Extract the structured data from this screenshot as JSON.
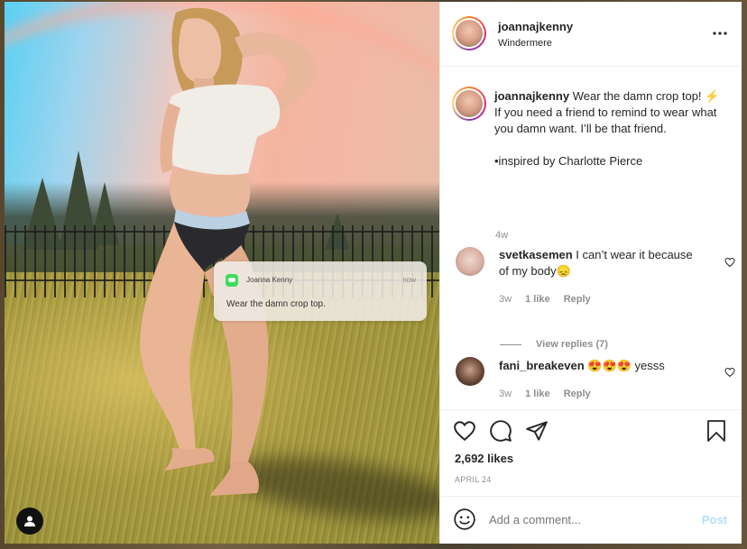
{
  "post": {
    "username": "joannajkenny",
    "location": "Windermere",
    "more_label": "•••",
    "caption_username": "joannajkenny",
    "caption_lines": [
      "Wear the damn crop top! ⚡",
      "If you need a friend to remind to wear what you damn want. I’ll be that friend.",
      "",
      "•inspired by Charlotte Pierce"
    ],
    "caption_age": "4w",
    "likes": "2,692 likes",
    "date": "APRIL 24",
    "add_comment_placeholder": "Add a comment...",
    "post_label": "Post"
  },
  "photo_overlay": {
    "sender": "Joanna Kenny",
    "time": "now",
    "message": "Wear the damn crop top."
  },
  "comments": [
    {
      "username": "svetkasemen",
      "text": "I can’t wear it because of my body😞",
      "age": "3w",
      "likes": "1 like",
      "reply": "Reply",
      "view_replies": "View replies (7)"
    },
    {
      "username": "fani_breakeven",
      "text": "😍😍😍 yesss",
      "age": "3w",
      "likes": "1 like",
      "reply": "Reply"
    }
  ],
  "colors": {
    "accent_post": "#b2dffc",
    "muted": "#8e8e8e",
    "text": "#262626"
  },
  "icons": [
    "heart-icon",
    "comment-icon",
    "share-icon",
    "bookmark-icon",
    "emoji-icon",
    "more-icon",
    "account-icon"
  ]
}
